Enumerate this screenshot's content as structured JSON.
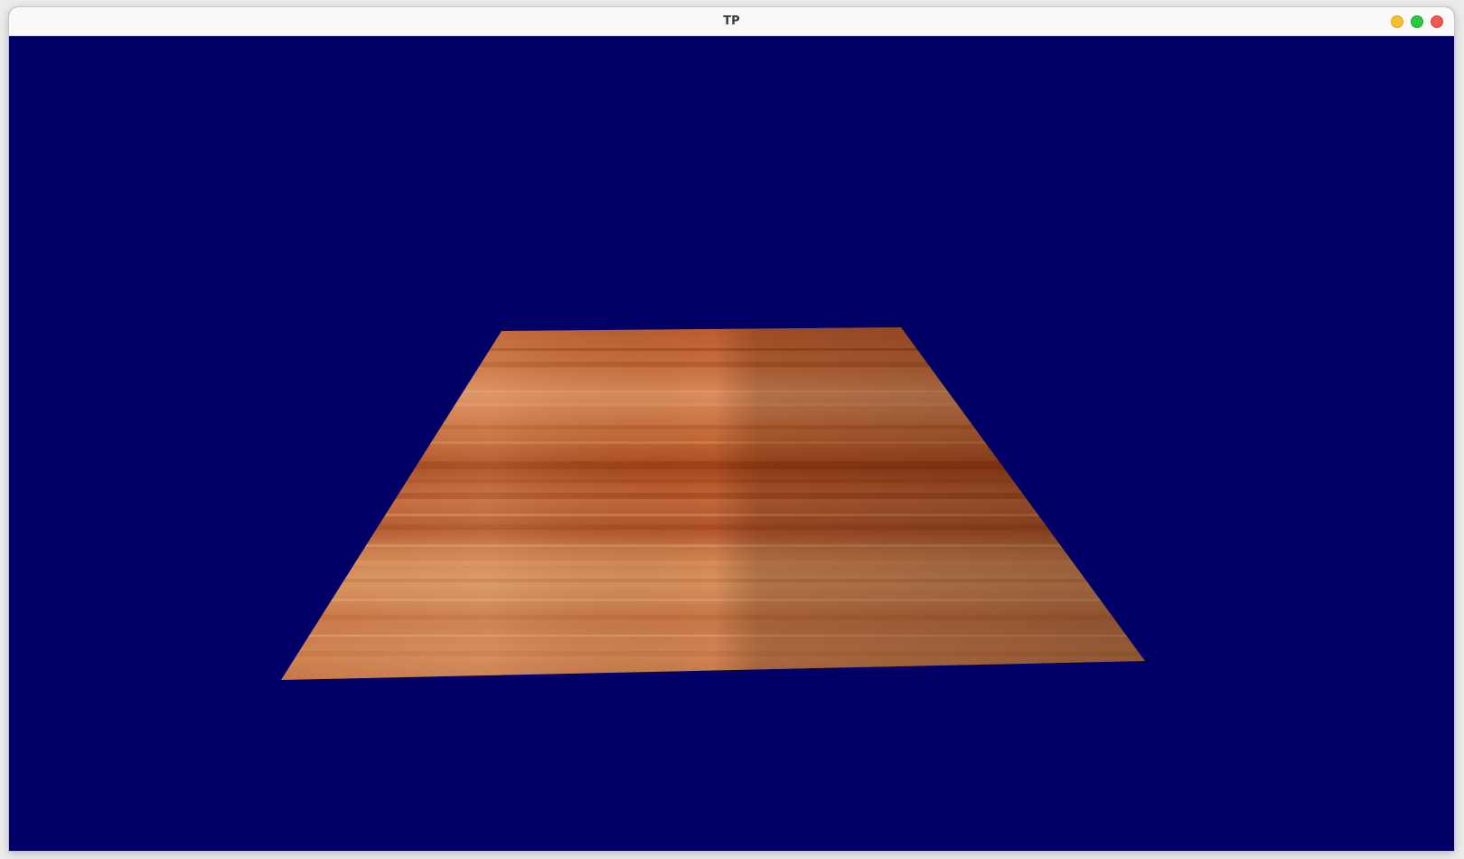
{
  "window": {
    "title": "TP",
    "controls": [
      {
        "name": "minimize-button",
        "color": "#f5c02b"
      },
      {
        "name": "maximize-button",
        "color": "#27c93f"
      },
      {
        "name": "close-button",
        "color": "#f0584f"
      }
    ]
  },
  "scene": {
    "background_color": "#000066",
    "object": "wood-plane",
    "wood_colors": [
      "#c8703f",
      "#a94a1f",
      "#d98f5f",
      "#7a3a18"
    ]
  }
}
